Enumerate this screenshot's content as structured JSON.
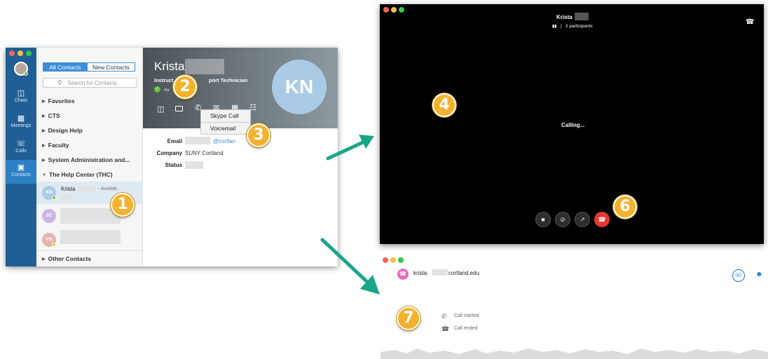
{
  "contacts_window": {
    "rail": {
      "chats": "Chats",
      "meetings": "Meetings",
      "calls": "Calls",
      "contacts": "Contacts"
    },
    "tabs": {
      "all": "All Contacts",
      "new": "New Contacts"
    },
    "search_placeholder": "Search for Contacts",
    "groups": [
      "Favorites",
      "CTS",
      "Design Help",
      "Faculty",
      "System Administration and...",
      "The Help Center (THC)"
    ],
    "other_group": "Other Contacts",
    "contact": {
      "initials": "KN",
      "name": "Krista",
      "status_text": "- Availab"
    },
    "other_initials": [
      "SC",
      "VM"
    ],
    "detail": {
      "name": "Krista",
      "title": "Instruct",
      "title_tail": "port Technician",
      "presence": "Av",
      "avatar_initials": "KN",
      "call_menu": [
        "Skype Call",
        "Voicemail"
      ],
      "email_label": "Email",
      "email_value": "@cortlan",
      "company_label": "Company",
      "company_value": "SUNY Cortland",
      "status_label": "Status"
    }
  },
  "call_window": {
    "name": "Krista",
    "participants": "2 participants",
    "calling": "Calling..."
  },
  "chat_window": {
    "email_prefix": "krista.",
    "email_suffix": "cortland.edu",
    "call_started": "Call started",
    "call_ended": "Call ended"
  },
  "badges": [
    "1",
    "2",
    "3",
    "4",
    "6",
    "7"
  ],
  "colors": {
    "rail": "#1f5f95",
    "accent": "#3b8fd6",
    "badge": "#f4b22c",
    "arrow": "#1aa589",
    "hangup": "#e53935"
  }
}
